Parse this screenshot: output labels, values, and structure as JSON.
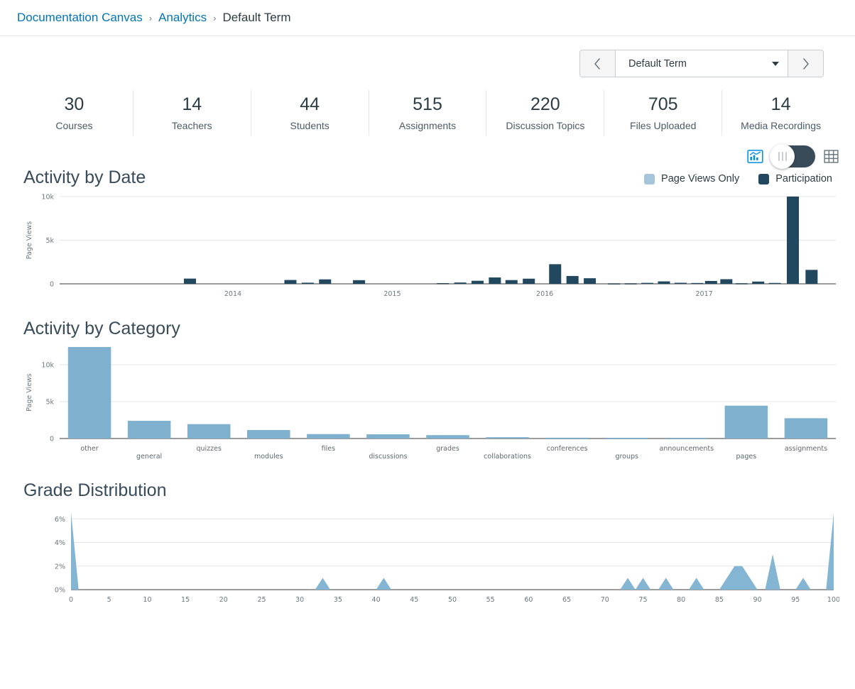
{
  "breadcrumb": {
    "items": [
      {
        "label": "Documentation Canvas",
        "link": true
      },
      {
        "label": "Analytics",
        "link": true
      },
      {
        "label": "Default Term",
        "link": false
      }
    ],
    "separator": "›"
  },
  "term_selector": {
    "prev_label": "‹",
    "next_label": "›",
    "value": "Default Term",
    "options": [
      "Default Term"
    ]
  },
  "stats": [
    {
      "value": "30",
      "label": "Courses"
    },
    {
      "value": "14",
      "label": "Teachers"
    },
    {
      "value": "44",
      "label": "Students"
    },
    {
      "value": "515",
      "label": "Assignments"
    },
    {
      "value": "220",
      "label": "Discussion Topics"
    },
    {
      "value": "705",
      "label": "Files Uploaded"
    },
    {
      "value": "14",
      "label": "Media Recordings"
    }
  ],
  "view_toggle": {
    "chart_icon": "bar-chart-icon",
    "table_icon": "table-grid-icon",
    "state": "chart",
    "chart_icon_color": "#008EE2",
    "table_icon_color": "#6B7780",
    "track_color": "#394B59"
  },
  "colors": {
    "page_views_only": "#A5C6DA",
    "participation": "#21485F",
    "category_bar": "#7FB0CE",
    "grade_area": "#84B5D3",
    "link": "#0374B5",
    "text": "#2D3B45",
    "grid": "#E3E6E8",
    "axis": "#9B9B9B"
  },
  "chart_data": [
    {
      "type": "bar",
      "title": "Activity by Date",
      "ylabel": "Page Views",
      "xlabel": "",
      "ylim": [
        0,
        10000
      ],
      "yticks": [
        "0",
        "5k",
        "10k"
      ],
      "ytick_values": [
        0,
        5000,
        10000
      ],
      "grid": true,
      "legend": [
        {
          "name": "Page Views Only",
          "color": "#A5C6DA"
        },
        {
          "name": "Participation",
          "color": "#21485F"
        }
      ],
      "legend_position": "top-right",
      "xtick_labels": [
        "2014",
        "2015",
        "2016",
        "2017"
      ],
      "xtick_positions": [
        0.25,
        0.48,
        0.7,
        0.93
      ],
      "series": [
        {
          "name": "Participation",
          "color": "#21485F",
          "points": [
            {
              "x": 0.188,
              "value": 600
            },
            {
              "x": 0.333,
              "value": 440
            },
            {
              "x": 0.358,
              "value": 130
            },
            {
              "x": 0.383,
              "value": 510
            },
            {
              "x": 0.432,
              "value": 420
            },
            {
              "x": 0.553,
              "value": 80
            },
            {
              "x": 0.578,
              "value": 150
            },
            {
              "x": 0.603,
              "value": 350
            },
            {
              "x": 0.628,
              "value": 730
            },
            {
              "x": 0.652,
              "value": 430
            },
            {
              "x": 0.677,
              "value": 590
            },
            {
              "x": 0.715,
              "value": 2250
            },
            {
              "x": 0.74,
              "value": 900
            },
            {
              "x": 0.765,
              "value": 640
            },
            {
              "x": 0.8,
              "value": 35
            },
            {
              "x": 0.824,
              "value": 45
            },
            {
              "x": 0.848,
              "value": 110
            },
            {
              "x": 0.872,
              "value": 280
            },
            {
              "x": 0.896,
              "value": 120
            },
            {
              "x": 0.92,
              "value": 95
            },
            {
              "x": 0.94,
              "value": 330
            },
            {
              "x": 0.962,
              "value": 530
            },
            {
              "x": 0.984,
              "value": 60
            },
            {
              "x": 1.008,
              "value": 260
            },
            {
              "x": 1.032,
              "value": 100
            },
            {
              "x": 1.058,
              "value": 10000
            },
            {
              "x": 1.085,
              "value": 1600
            }
          ]
        }
      ]
    },
    {
      "type": "bar",
      "title": "Activity by Category",
      "ylabel": "Page Views",
      "xlabel": "",
      "ylim": [
        0,
        12500
      ],
      "yticks": [
        "0",
        "5k",
        "10k"
      ],
      "ytick_values": [
        0,
        5000,
        10000
      ],
      "grid": true,
      "categories": [
        "other",
        "general",
        "quizzes",
        "modules",
        "files",
        "discussions",
        "grades",
        "collaborations",
        "conferences",
        "groups",
        "announcements",
        "pages",
        "assignments"
      ],
      "values": [
        12400,
        2400,
        1950,
        1150,
        600,
        570,
        460,
        180,
        110,
        90,
        80,
        4450,
        2750
      ],
      "bar_color": "#7FB0CE"
    },
    {
      "type": "area",
      "title": "Grade Distribution",
      "ylabel": "",
      "xlabel": "",
      "ylim": [
        0,
        6.8
      ],
      "yticks": [
        "0%",
        "2%",
        "4%",
        "6%"
      ],
      "ytick_values": [
        0,
        2,
        4,
        6
      ],
      "xlim": [
        0,
        100
      ],
      "xticks": [
        "0",
        "5",
        "10",
        "15",
        "20",
        "25",
        "30",
        "35",
        "40",
        "45",
        "50",
        "55",
        "60",
        "65",
        "70",
        "75",
        "80",
        "85",
        "90",
        "95",
        "100"
      ],
      "grid": true,
      "area_color": "#84B5D3",
      "points": [
        {
          "x": 0,
          "y": 6.6
        },
        {
          "x": 1,
          "y": 0
        },
        {
          "x": 32,
          "y": 0
        },
        {
          "x": 33,
          "y": 1.0
        },
        {
          "x": 34,
          "y": 0
        },
        {
          "x": 40,
          "y": 0
        },
        {
          "x": 41,
          "y": 1.0
        },
        {
          "x": 42,
          "y": 0
        },
        {
          "x": 72,
          "y": 0
        },
        {
          "x": 73,
          "y": 1.0
        },
        {
          "x": 74,
          "y": 0
        },
        {
          "x": 74,
          "y": 0
        },
        {
          "x": 75,
          "y": 1.0
        },
        {
          "x": 76,
          "y": 0
        },
        {
          "x": 77,
          "y": 0
        },
        {
          "x": 78,
          "y": 1.0
        },
        {
          "x": 79,
          "y": 0
        },
        {
          "x": 81,
          "y": 0
        },
        {
          "x": 82,
          "y": 1.0
        },
        {
          "x": 83,
          "y": 0
        },
        {
          "x": 85,
          "y": 0
        },
        {
          "x": 87,
          "y": 2.0
        },
        {
          "x": 88,
          "y": 2.0
        },
        {
          "x": 90,
          "y": 0
        },
        {
          "x": 91,
          "y": 0
        },
        {
          "x": 92,
          "y": 3.0
        },
        {
          "x": 93,
          "y": 0
        },
        {
          "x": 95,
          "y": 0
        },
        {
          "x": 96,
          "y": 1.0
        },
        {
          "x": 97,
          "y": 0
        },
        {
          "x": 99,
          "y": 0
        },
        {
          "x": 100,
          "y": 6.5
        }
      ]
    }
  ]
}
